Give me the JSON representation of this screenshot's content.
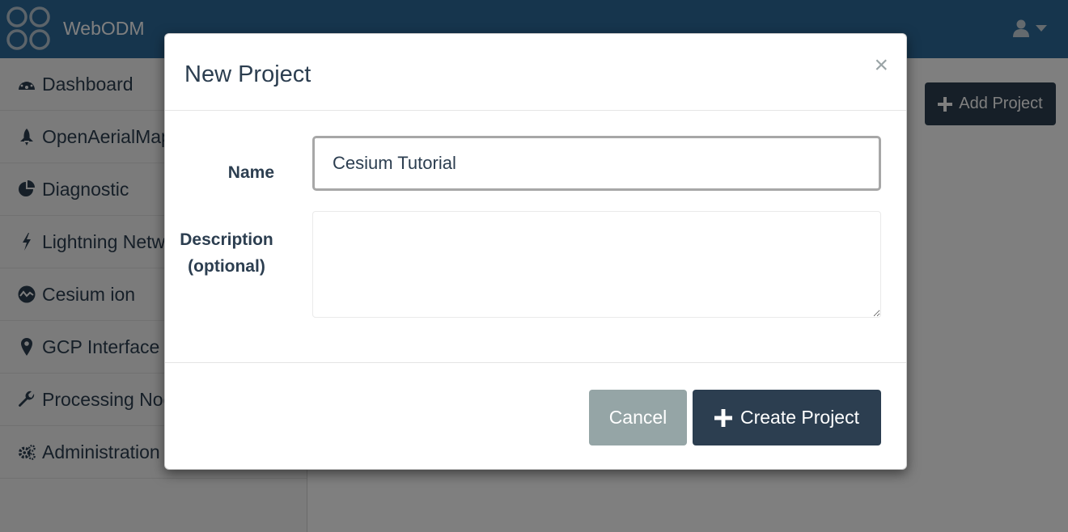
{
  "navbar": {
    "brand_name": "WebODM",
    "logo_icon": "drone-logo-icon",
    "user_icon": "user-icon",
    "user_caret_icon": "caret-down-icon"
  },
  "sidebar": {
    "items": [
      {
        "label": "Dashboard",
        "icon": "dashboard-icon"
      },
      {
        "label": "OpenAerialMap",
        "icon": "rocket-icon"
      },
      {
        "label": "Diagnostic",
        "icon": "pie-chart-icon"
      },
      {
        "label": "Lightning Network",
        "icon": "bolt-icon"
      },
      {
        "label": "Cesium ion",
        "icon": "cesium-icon"
      },
      {
        "label": "GCP Interface",
        "icon": "map-marker-icon"
      },
      {
        "label": "Processing Nodes",
        "icon": "wrench-icon"
      },
      {
        "label": "Administration",
        "icon": "gears-icon"
      }
    ]
  },
  "main": {
    "add_project_label": "Add Project"
  },
  "modal": {
    "title": "New Project",
    "close_label": "×",
    "name_label": "Name",
    "name_value": "Cesium Tutorial",
    "description_label_line1": "Description",
    "description_label_line2": "(optional)",
    "description_value": "",
    "cancel_label": "Cancel",
    "create_label": "Create Project"
  }
}
